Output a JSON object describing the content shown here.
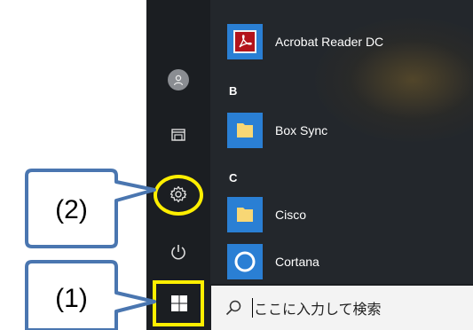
{
  "callouts": {
    "label_1": "(1)",
    "label_2": "(2)",
    "border_color": "#4a76b0",
    "highlight_color": "#ffef00"
  },
  "start_menu": {
    "rail_icons": [
      "user-icon",
      "documents-icon",
      "settings-icon",
      "power-icon"
    ],
    "groups": [
      {
        "letter": "",
        "apps": [
          {
            "label": "Acrobat Reader DC",
            "icon": "acrobat-icon"
          }
        ]
      },
      {
        "letter": "B",
        "apps": [
          {
            "label": "Box Sync",
            "icon": "folder-icon"
          }
        ]
      },
      {
        "letter": "C",
        "apps": [
          {
            "label": "Cisco",
            "icon": "folder-icon"
          },
          {
            "label": "Cortana",
            "icon": "cortana-icon"
          }
        ]
      }
    ]
  },
  "taskbar": {
    "search_placeholder": "ここに入力して検索",
    "start_icon": "windows-logo-icon",
    "search_icon": "search-icon"
  },
  "colors": {
    "tile_blue": "#2a7fd4",
    "acrobat_red": "#b3131b",
    "folder_yellow": "#f8d775"
  }
}
